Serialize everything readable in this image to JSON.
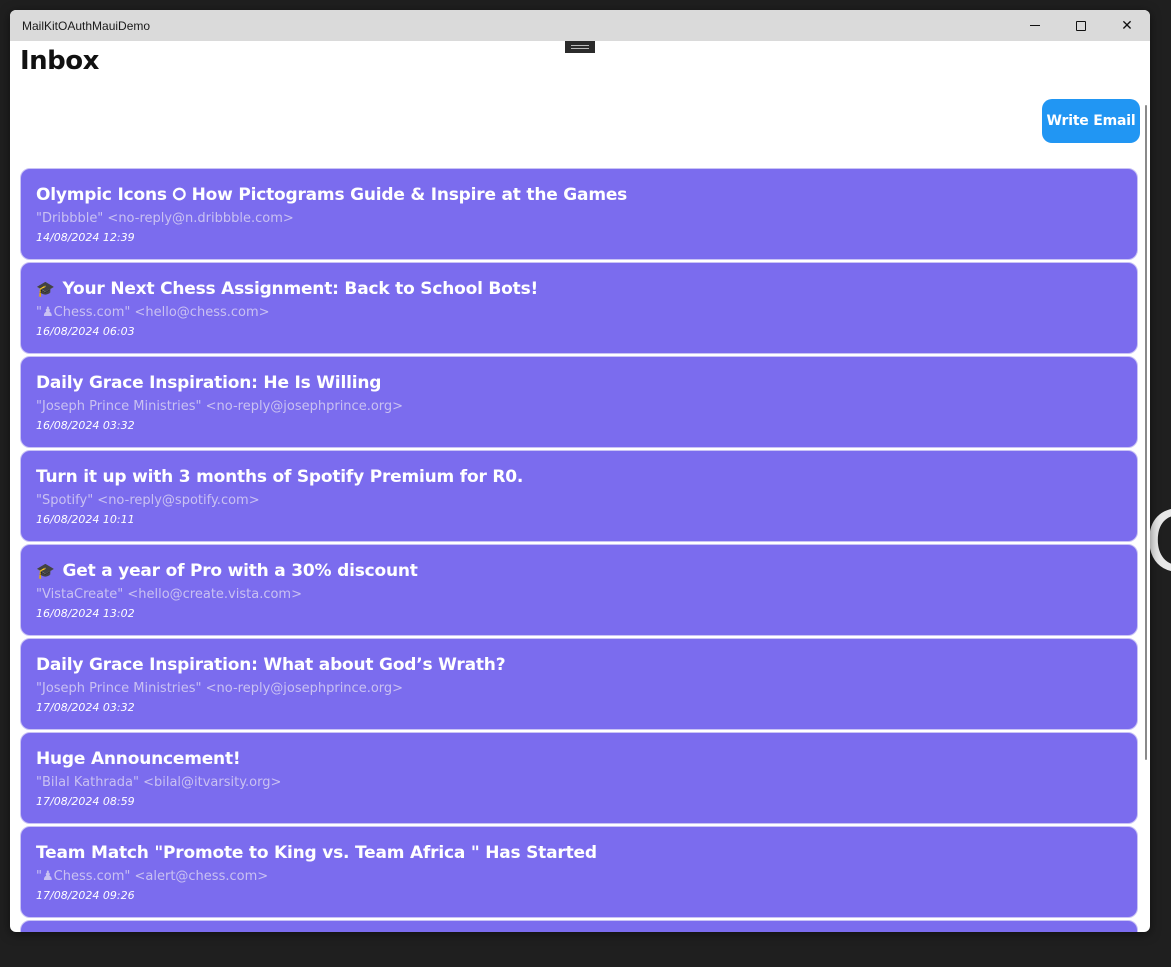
{
  "window": {
    "title": "MailKitOAuthMauiDemo",
    "minimize_icon": "minimize-icon",
    "maximize_icon": "maximize-icon",
    "close_icon": "close-icon",
    "close_glyph": "✕"
  },
  "desktop": {
    "edge_glyph": "O"
  },
  "page": {
    "title": "Inbox"
  },
  "toolbar": {
    "write_label": "Write Email"
  },
  "colors": {
    "card_bg": "#7b6cee",
    "button_bg": "#2196f3"
  },
  "emails": [
    {
      "icon": "",
      "subject": "Olympic Icons ⭘ How Pictograms Guide & Inspire at the Games",
      "from": "\"Dribbble\" <no-reply@n.dribbble.com>",
      "date": "14/08/2024 12:39"
    },
    {
      "icon": "🎓",
      "subject": "Your Next Chess Assignment: Back to School Bots!",
      "from": "\"♟Chess.com\" <hello@chess.com>",
      "date": "16/08/2024 06:03"
    },
    {
      "icon": "",
      "subject": "Daily Grace Inspiration: He Is Willing",
      "from": "\"Joseph Prince Ministries\" <no-reply@josephprince.org>",
      "date": "16/08/2024 03:32"
    },
    {
      "icon": "",
      "subject": "Turn it up with 3 months of Spotify Premium for R0.",
      "from": "\"Spotify\" <no-reply@spotify.com>",
      "date": "16/08/2024 10:11"
    },
    {
      "icon": "🎓",
      "subject": "Get a year of Pro with a 30% discount",
      "from": "\"VistaCreate\" <hello@create.vista.com>",
      "date": "16/08/2024 13:02"
    },
    {
      "icon": "",
      "subject": "Daily Grace Inspiration: What about God’s Wrath?",
      "from": "\"Joseph Prince Ministries\" <no-reply@josephprince.org>",
      "date": "17/08/2024 03:32"
    },
    {
      "icon": "",
      "subject": "Huge Announcement!",
      "from": "\"Bilal Kathrada\" <bilal@itvarsity.org>",
      "date": "17/08/2024 08:59"
    },
    {
      "icon": "",
      "subject": "Team Match \"Promote to King vs. Team Africa \" Has Started",
      "from": "\"♟Chess.com\" <alert@chess.com>",
      "date": "17/08/2024 09:26"
    }
  ]
}
